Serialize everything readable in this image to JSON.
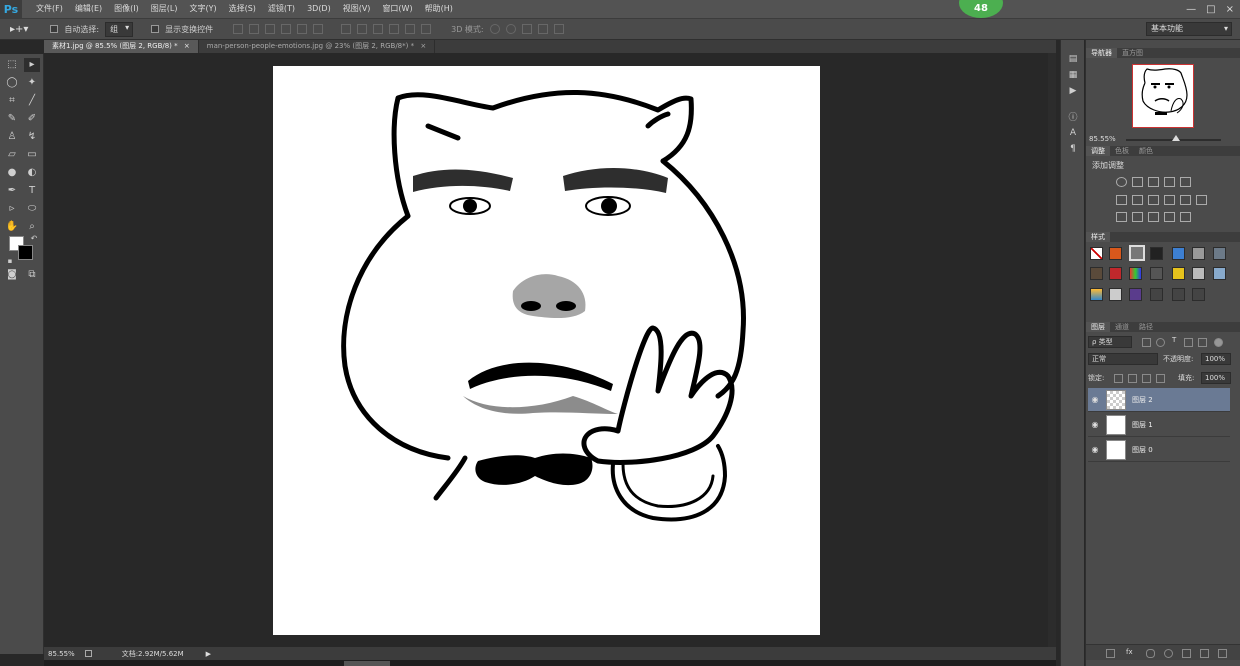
{
  "app": {
    "logo": "Ps"
  },
  "menubar": {
    "items": [
      "文件(F)",
      "编辑(E)",
      "图像(I)",
      "图层(L)",
      "文字(Y)",
      "选择(S)",
      "滤镜(T)",
      "3D(D)",
      "视图(V)",
      "窗口(W)",
      "帮助(H)"
    ],
    "badge": "48",
    "window_controls": [
      "—",
      "□",
      "×"
    ]
  },
  "options": {
    "auto_select_label": "自动选择:",
    "auto_select_value": "组",
    "transform_controls_label": "显示变换控件",
    "mode_3d_label": "3D 模式:",
    "workspace": "基本功能"
  },
  "tabs": [
    {
      "label": "素材1.jpg @ 85.5% (图层 2, RGB/8) *",
      "close": "×",
      "active": true
    },
    {
      "label": "man-person-people-emotions.jpg @ 23% (图层 2, RGB/8*) *",
      "close": "×",
      "active": false
    }
  ],
  "status": {
    "zoom": "85.55%",
    "doc_info": "文档:2.92M/5.62M",
    "arrow": "▶"
  },
  "navigator": {
    "tabs": [
      "导航器",
      "直方图"
    ],
    "zoom": "85.55%"
  },
  "adjustments": {
    "tabs": [
      "调整",
      "色板",
      "颜色"
    ],
    "title": "添加调整"
  },
  "styles": {
    "tabs": [
      "样式"
    ]
  },
  "layers": {
    "tabs": [
      "图层",
      "通道",
      "路径"
    ],
    "kind_filter": "ρ 类型",
    "blend_mode": "正常",
    "opacity_label": "不透明度:",
    "opacity": "100%",
    "lock_label": "锁定:",
    "fill_label": "填充:",
    "fill": "100%",
    "list": [
      {
        "name": "图层 2",
        "selected": true
      },
      {
        "name": "图层 1",
        "selected": false
      },
      {
        "name": "图层 0",
        "selected": false
      }
    ]
  }
}
